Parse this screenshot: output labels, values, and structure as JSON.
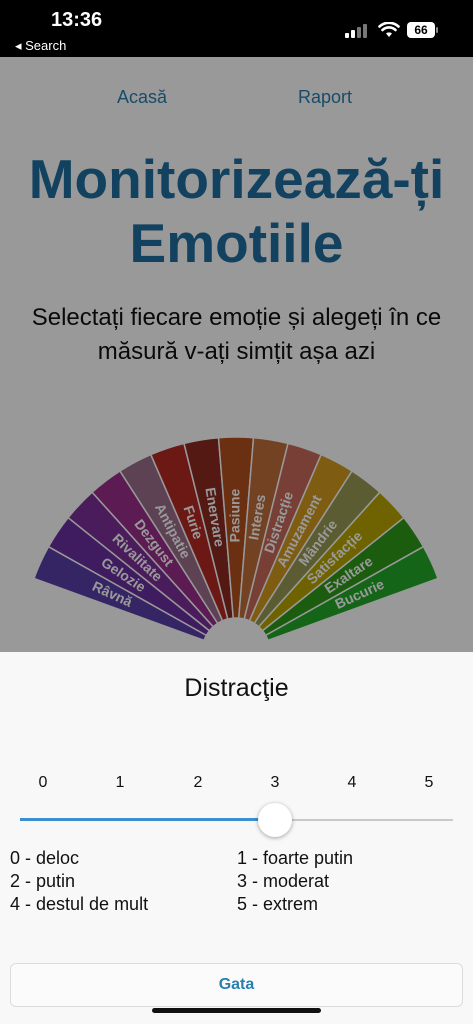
{
  "status": {
    "time": "13:36",
    "back_label": "◂ Search",
    "battery": "66"
  },
  "nav": {
    "home": "Acasă",
    "report": "Raport"
  },
  "title": "Monitorizează-ți Emotiile",
  "subtitle": "Selectați fiecare emoție și alegeți în ce măsură v-ați simțit așa azi",
  "wheel_labels": [
    "Râvnă",
    "Gelozie",
    "Rivalitate",
    "Dezgust",
    "Antipatie",
    "Furie",
    "Enervare",
    "Pasiune",
    "Interes",
    "Distracție",
    "Amuzament",
    "Mândrie",
    "Satisfacție",
    "Exaltare",
    "Bucurie"
  ],
  "wheel_colors": [
    "#5b3fa8",
    "#6a2e9e",
    "#7d2f9a",
    "#9a2f8b",
    "#9b6f8a",
    "#b52b25",
    "#8a2a1e",
    "#b24f1e",
    "#c06f3a",
    "#c96a5a",
    "#d39a1d",
    "#9a9a55",
    "#b8a600",
    "#2f9a1a",
    "#23a82a"
  ],
  "sheet": {
    "title": "Distracţie",
    "ticks": [
      "0",
      "1",
      "2",
      "3",
      "4",
      "5"
    ],
    "value": 3,
    "max": 5,
    "legend": [
      "0 - deloc",
      "1 - foarte putin",
      "2 - putin",
      "3 - moderat",
      "4 - destul de mult",
      "5 - extrem"
    ],
    "done_label": "Gata"
  },
  "colors": {
    "accent": "#2a7fb0",
    "slider": "#3a8fd2",
    "title": "#1f6fa0"
  }
}
